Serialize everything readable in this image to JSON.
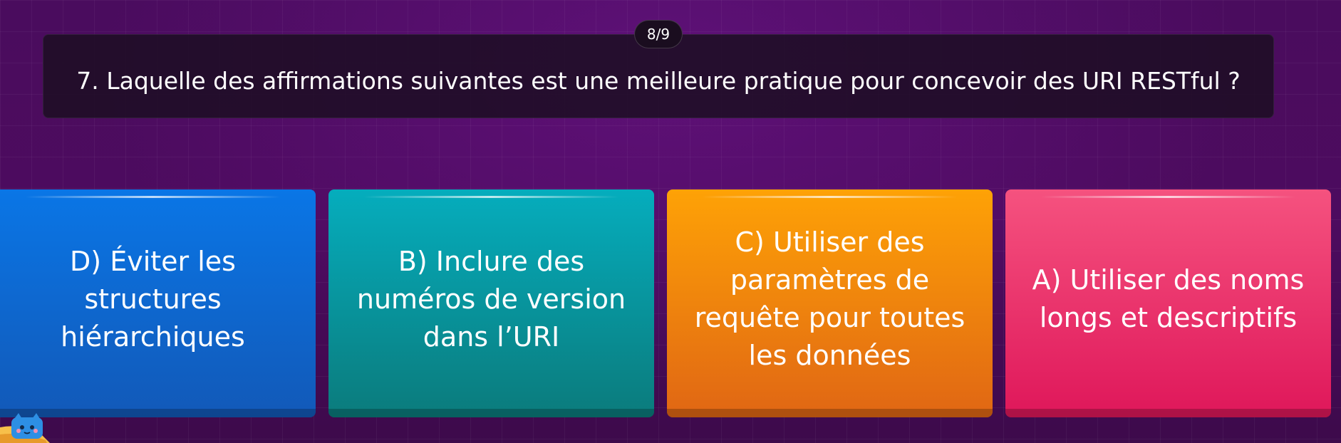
{
  "progress": {
    "label": "8/9"
  },
  "question": {
    "text": "7. Laquelle des affirmations suivantes est une meilleure pratique pour concevoir des URI RESTful ?"
  },
  "answers": [
    {
      "label": "D) Éviter les structures hiérarchiques",
      "color": "#0a76e6"
    },
    {
      "label": "B) Inclure des numéros de version dans l’URI",
      "color": "#05adbd"
    },
    {
      "label": "C) Utiliser des paramètres de requête pour toutes les données",
      "color": "#fea206"
    },
    {
      "label": "A) Utiliser des noms longs et descriptifs",
      "color": "#f5527f"
    }
  ],
  "mascot": {
    "icon": "cat-mascot-icon"
  }
}
